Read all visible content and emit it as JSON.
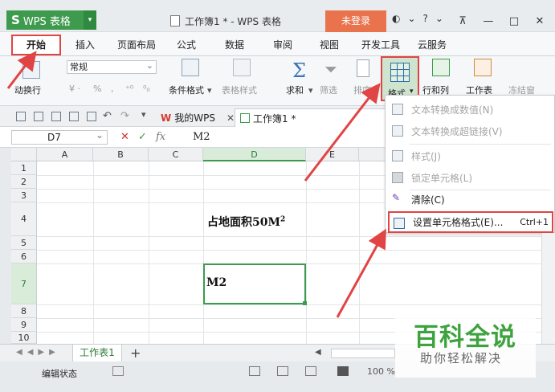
{
  "titlebar": {
    "app_button": "WPS 表格",
    "doc_title": "工作簿1 * - WPS 表格",
    "login": "未登录",
    "help": "?"
  },
  "menu": {
    "tabs": [
      "开始",
      "插入",
      "页面布局",
      "公式",
      "数据",
      "审阅",
      "视图",
      "开发工具",
      "云服务"
    ]
  },
  "ribbon": {
    "wrap_label": "动换行",
    "number_format": "常规",
    "percent": "%",
    "conditional_format": "条件格式",
    "table_style": "表格样式",
    "sum": "求和",
    "filter": "筛选",
    "sort": "排序",
    "format": "格式",
    "rows_cols": "行和列",
    "sheet": "工作表",
    "freeze": "冻结窗"
  },
  "tabs_bar": {
    "my_wps": "我的WPS",
    "workbook": "工作簿1 *"
  },
  "formula_bar": {
    "name_box": "D7",
    "fx": "fx",
    "content": "M2"
  },
  "grid": {
    "columns": [
      "A",
      "B",
      "C",
      "D",
      "E"
    ],
    "rows": [
      "1",
      "2",
      "3",
      "4",
      "5",
      "6",
      "7",
      "8",
      "9",
      "10"
    ],
    "d4_text": "占地面积50M",
    "d4_sup": "2",
    "d7_text": "M2"
  },
  "dropdown": {
    "items": [
      {
        "label": "文本转换成数值(N)"
      },
      {
        "label": "文本转换成超链接(V)"
      },
      {
        "label": "样式(J)"
      },
      {
        "label": "锁定单元格(L)"
      },
      {
        "label": "清除(C)"
      },
      {
        "label": "设置单元格格式(E)...",
        "shortcut": "Ctrl+1"
      }
    ]
  },
  "sheets": {
    "active": "工作表1",
    "add": "+"
  },
  "status": {
    "mode": "编辑状态",
    "zoom": "100 %"
  },
  "watermark": {
    "title": "百科全说",
    "subtitle": "助你轻松解决"
  },
  "colors": {
    "accent_green": "#3e9a4d",
    "highlight_red": "#e14444",
    "login_orange": "#e9734c"
  }
}
